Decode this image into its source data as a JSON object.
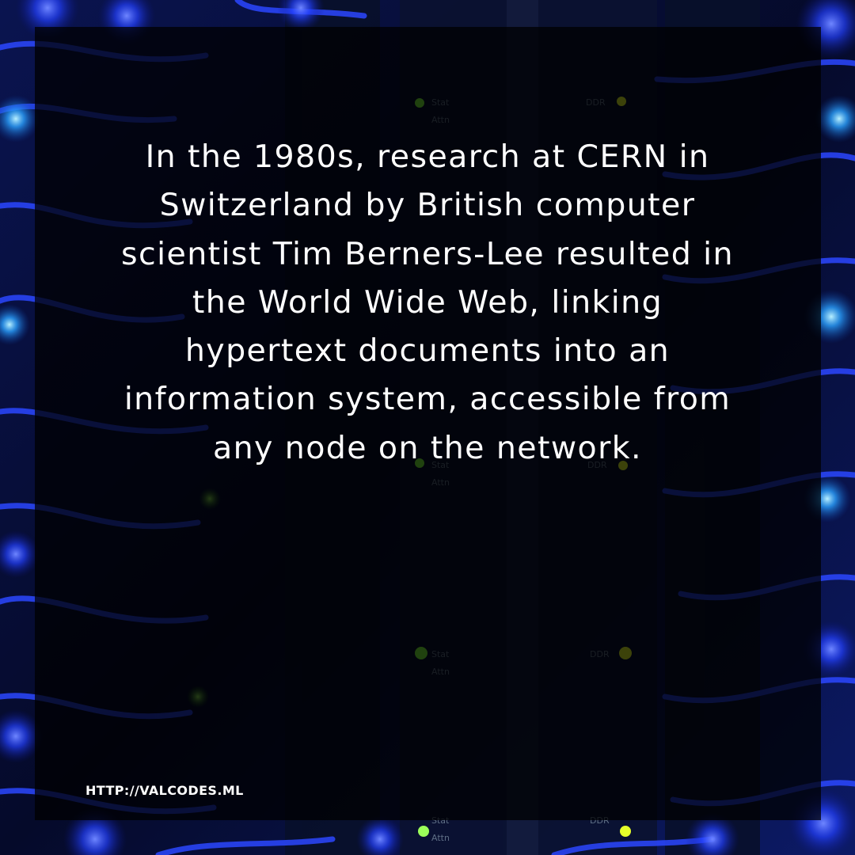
{
  "background": {
    "description_icon": "server-rack-photo",
    "accent": "#1a3cff",
    "led_green": "#7dff3a",
    "led_yellow": "#e6ff2a",
    "panel_labels": {
      "stat": "Stat",
      "attn": "Attn",
      "ddr": "DDR"
    }
  },
  "quote": {
    "text": "In the 1980s, research at CERN in\nSwitzerland by British computer\nscientist Tim Berners-Lee resulted in\nthe World Wide Web, linking\nhypertext documents into an\ninformation system, accessible from\nany node on the network."
  },
  "footer": {
    "website": "HTTP://VALCODES.ML"
  }
}
